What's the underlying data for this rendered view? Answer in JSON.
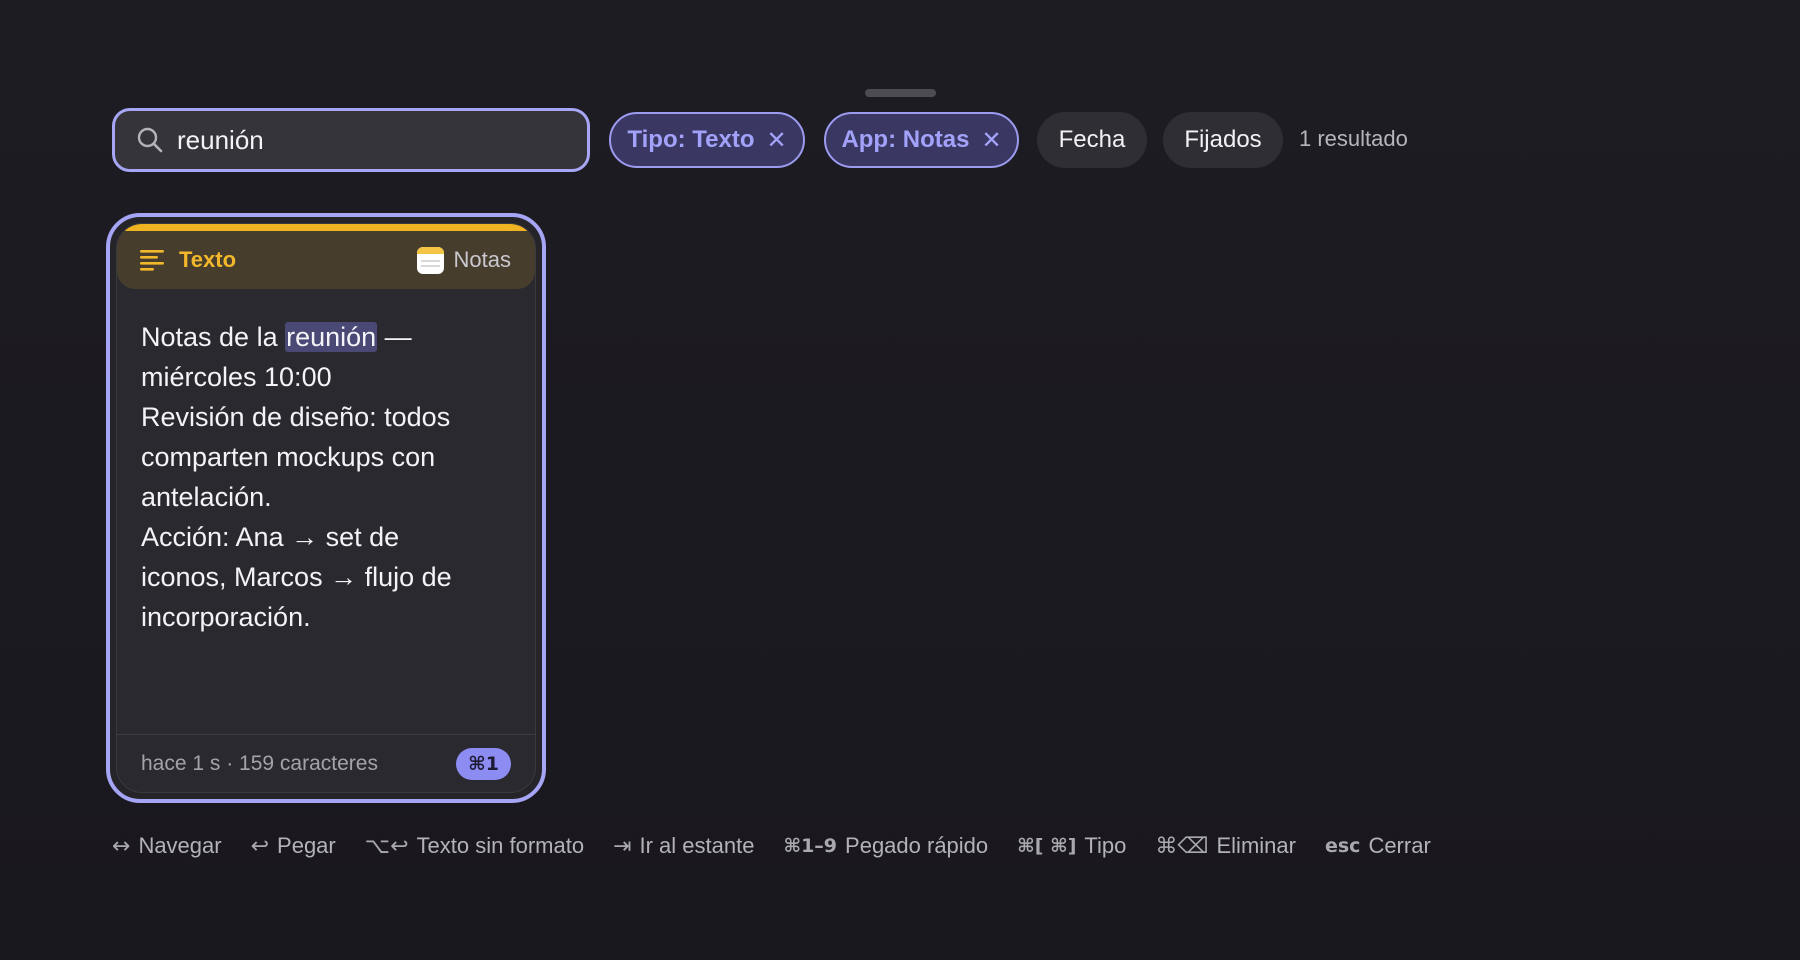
{
  "search": {
    "value": "reunión",
    "icon": "search-icon"
  },
  "filters": {
    "active": [
      {
        "label": "Tipo: Texto",
        "remove_glyph": "✕"
      },
      {
        "label": "App: Notas",
        "remove_glyph": "✕"
      }
    ],
    "inactive": [
      {
        "label": "Fecha"
      },
      {
        "label": "Fijados"
      }
    ],
    "result_count": "1 resultado"
  },
  "card": {
    "type_label": "Texto",
    "type_icon": "text-lines-icon",
    "app_name": "Notas",
    "app_icon": "notes-app-icon",
    "body": {
      "l1_before": "Notas de la ",
      "l1_highlight": "reunión",
      "l1_after": " —",
      "l2": "miércoles 10:00",
      "l3": "Revisión de diseño: todos",
      "l4": "comparten mockups con",
      "l5": "antelación.",
      "l6": "Acción: Ana → set de",
      "l7": "iconos, Marcos → flujo de",
      "l8": "incorporación."
    },
    "meta": "hace 1 s · 159 caracteres",
    "shortcut": "⌘1"
  },
  "hints": [
    {
      "key": "↔",
      "label": "Navegar"
    },
    {
      "key": "↩",
      "label": "Pegar"
    },
    {
      "key": "⌥↩",
      "label": "Texto sin formato"
    },
    {
      "key": "⇥",
      "label": "Ir al estante"
    },
    {
      "key": "⌘1–9",
      "label": "Pegado rápido"
    },
    {
      "key": "⌘[ ⌘]",
      "label": "Tipo"
    },
    {
      "key": "⌘⌫",
      "label": "Eliminar"
    },
    {
      "key": "esc",
      "label": "Cerrar"
    }
  ],
  "colors": {
    "accent": "#a6a5f5",
    "text_type": "#f0b321",
    "background": "#1b1a20"
  }
}
